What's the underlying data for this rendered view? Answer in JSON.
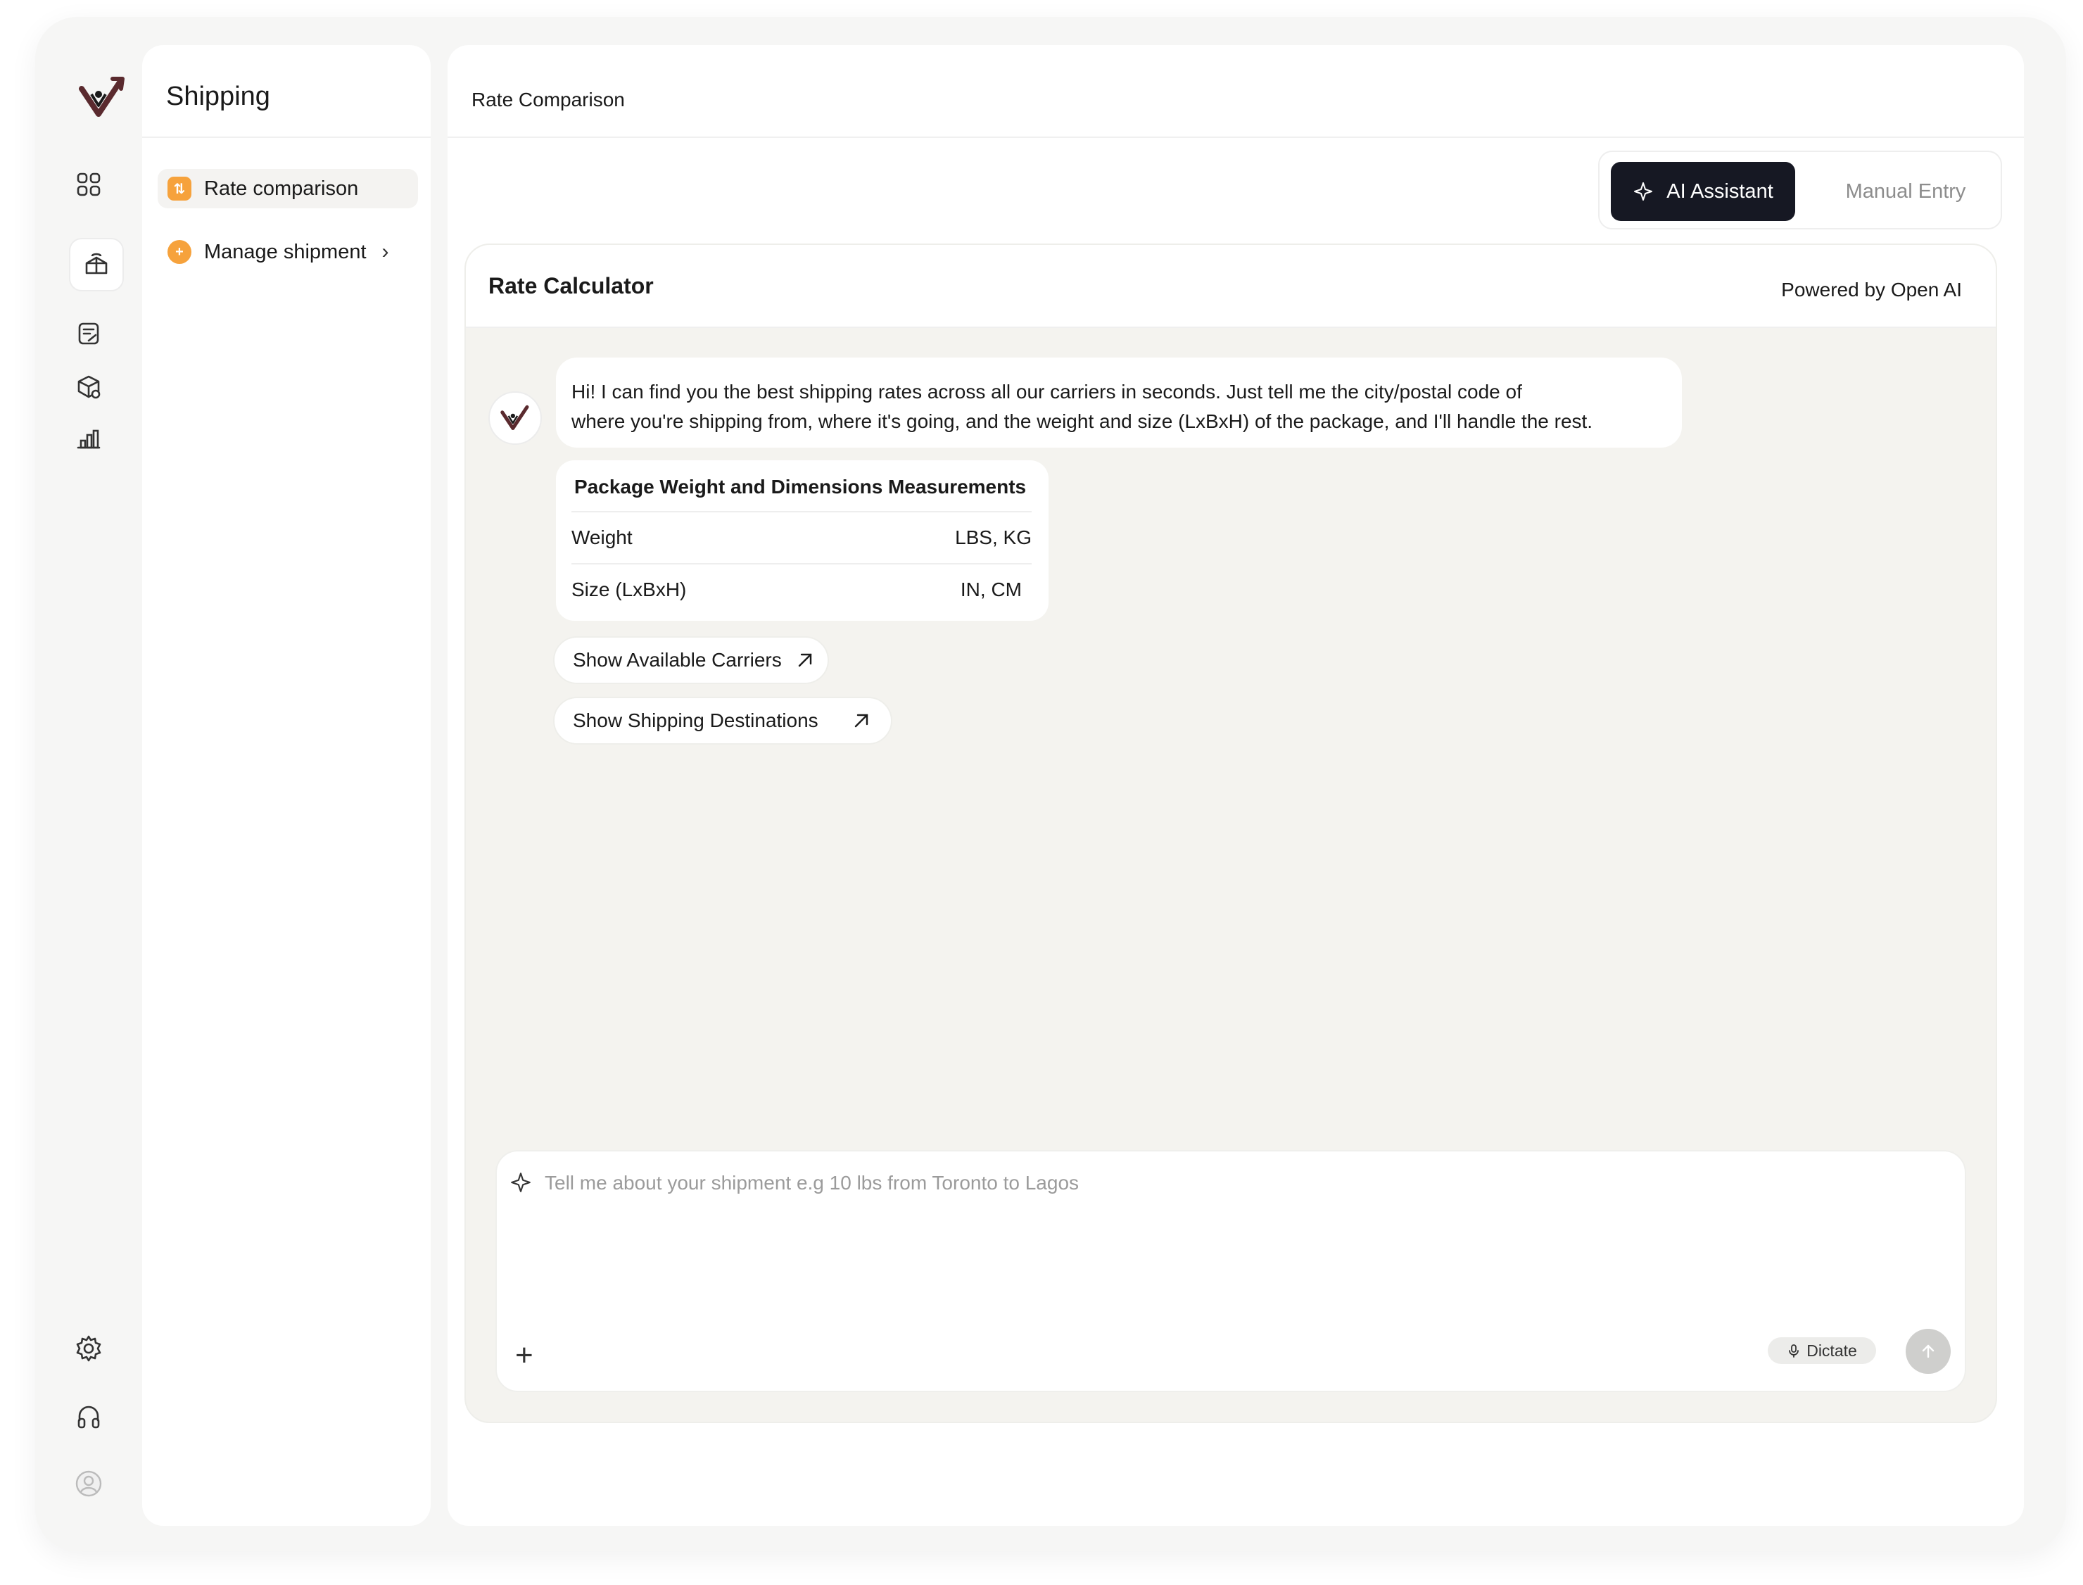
{
  "sidebar": {
    "rail_icons": [
      "logo-icon",
      "grid-icon",
      "shipping-box-icon",
      "notes-icon",
      "package-icon",
      "analytics-icon",
      "settings-icon",
      "support-headset-icon",
      "user-avatar-icon"
    ],
    "title": "Shipping",
    "items": [
      {
        "label": "Rate comparison",
        "active": true
      },
      {
        "label": "Manage shipment",
        "active": false
      }
    ]
  },
  "header": {
    "breadcrumb": "Rate Comparison"
  },
  "mode_toggle": {
    "ai_label": "AI Assistant",
    "manual_label": "Manual Entry",
    "selected": "AI Assistant"
  },
  "calculator": {
    "title": "Rate Calculator",
    "powered_by": "Powered by Open AI",
    "message_line1": "Hi! I can find you the best shipping rates across all our carriers in seconds. Just tell me the city/postal code of",
    "message_line2": "where you're shipping from, where it's going, and the weight and size (LxBxH) of the package, and I'll handle the rest.",
    "measurements": {
      "title": "Package Weight and Dimensions Measurements",
      "rows": [
        {
          "label": "Weight",
          "units": "LBS, KG"
        },
        {
          "label": "Size (LxBxH)",
          "units": "IN, CM"
        }
      ]
    },
    "suggestions": [
      {
        "label": "Show Available Carriers"
      },
      {
        "label": "Show Shipping Destinations"
      }
    ]
  },
  "composer": {
    "value": "",
    "placeholder": "Tell me about your shipment e.g 10 lbs from Toronto to Lagos",
    "dictate_label": "Dictate"
  },
  "colors": {
    "accent_orange": "#f6a23c",
    "primary_dark": "#161823",
    "logo_maroon": "#5a2a2e",
    "chat_bg": "#f4f3ef"
  }
}
